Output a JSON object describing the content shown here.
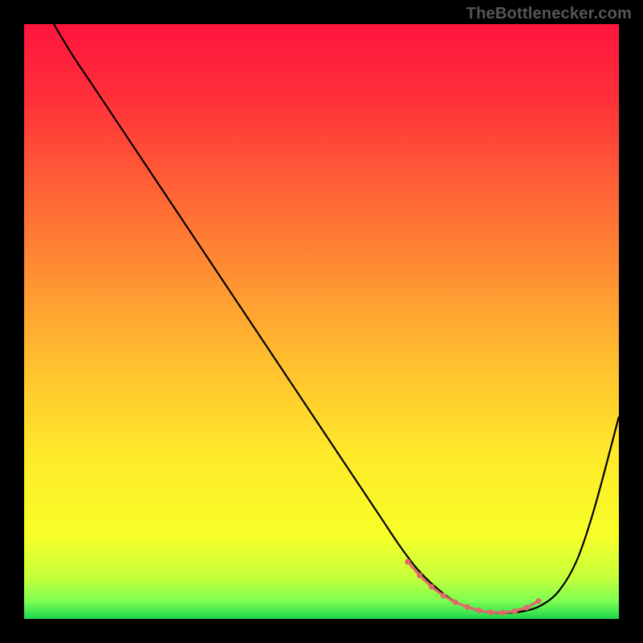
{
  "watermark": "TheBottlenecker.com",
  "plot": {
    "gradient_stops": [
      {
        "offset": "0%",
        "color": "#ff153e"
      },
      {
        "offset": "12%",
        "color": "#ff2f3a"
      },
      {
        "offset": "28%",
        "color": "#ff6336"
      },
      {
        "offset": "44%",
        "color": "#ff9632"
      },
      {
        "offset": "58%",
        "color": "#ffc22e"
      },
      {
        "offset": "72%",
        "color": "#ffe82a"
      },
      {
        "offset": "86%",
        "color": "#f7ff28"
      },
      {
        "offset": "93%",
        "color": "#c6ff3a"
      },
      {
        "offset": "97%",
        "color": "#7dff52"
      },
      {
        "offset": "100%",
        "color": "#1fd64f"
      }
    ],
    "curve_color": "#000000",
    "curve_width": 2.2,
    "marker_color": "#e06a6a",
    "marker_line_color": "#e06a6a",
    "marker_line_width": 3.3
  },
  "chart_data": {
    "type": "line",
    "title": "",
    "xlabel": "",
    "ylabel": "",
    "xlim": [
      0,
      100
    ],
    "ylim": [
      0,
      100
    ],
    "series": [
      {
        "name": "curve",
        "x": [
          5,
          8,
          12,
          18,
          24,
          30,
          36,
          42,
          48,
          54,
          60,
          63,
          66,
          69,
          72,
          75,
          78,
          81,
          84,
          87,
          90,
          93,
          96,
          100
        ],
        "y": [
          100,
          95,
          89,
          80,
          71,
          62,
          53,
          44,
          35,
          26,
          17,
          12.5,
          8.5,
          5.5,
          3.2,
          1.8,
          1.1,
          1.0,
          1.3,
          2.3,
          4.8,
          10,
          19,
          34
        ]
      }
    ],
    "markers": {
      "name": "highlight",
      "style": "dotted-line",
      "x": [
        64.5,
        66.5,
        68.5,
        70.5,
        72.5,
        74.5,
        76.5,
        78.5,
        80.5,
        82.5,
        84.5,
        86.5
      ],
      "y": [
        9.6,
        7.3,
        5.4,
        3.9,
        2.8,
        2.0,
        1.4,
        1.1,
        1.05,
        1.3,
        1.9,
        3.0
      ]
    }
  }
}
